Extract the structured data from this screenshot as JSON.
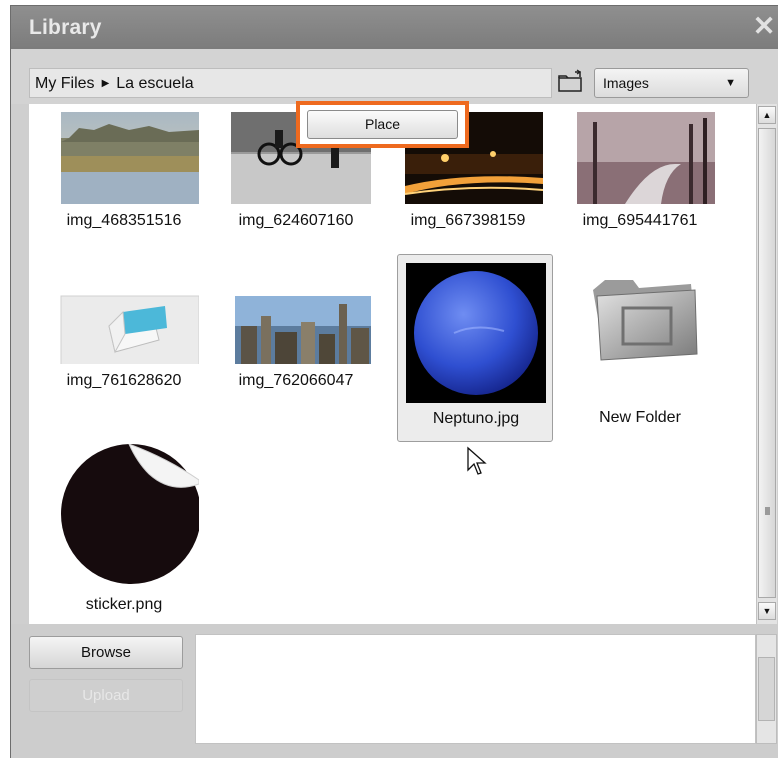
{
  "window": {
    "title": "Library",
    "close_glyph": "✕"
  },
  "toolbar": {
    "breadcrumb": [
      "My Files",
      "La escuela"
    ],
    "breadcrumb_separator_icon": "triangle-right-icon",
    "folder_up_icon": "folder-up-icon",
    "type_filter": {
      "selected": "Images",
      "arrow": "▼"
    }
  },
  "files": [
    {
      "name": "img_468351516",
      "kind": "image",
      "thumb": "landscape-lake"
    },
    {
      "name": "img_624607160",
      "kind": "image",
      "thumb": "bw-cyclists"
    },
    {
      "name": "img_667398159",
      "kind": "image",
      "thumb": "night-city-lights"
    },
    {
      "name": "img_695441761",
      "kind": "image",
      "thumb": "winter-park-path"
    },
    {
      "name": "img_761628620",
      "kind": "image",
      "thumb": "product-box"
    },
    {
      "name": "img_762066047",
      "kind": "image",
      "thumb": "city-skyline"
    },
    {
      "name": "Neptuno.jpg",
      "kind": "image",
      "thumb": "neptune-planet",
      "selected": true
    },
    {
      "name": "New Folder",
      "kind": "folder",
      "thumb": "folder-icon"
    },
    {
      "name": "sticker.png",
      "kind": "image",
      "thumb": "sticker-circle"
    }
  ],
  "context_popup": {
    "place_label": "Place",
    "highlight_color": "#ee6a1f"
  },
  "actions": {
    "browse_label": "Browse",
    "upload_label": "Upload"
  },
  "scrollbar": {
    "up": "▲",
    "down": "▼"
  },
  "colors": {
    "titlebar": "#858585",
    "pane": "#ffffff",
    "chrome": "#cfcfcf"
  }
}
